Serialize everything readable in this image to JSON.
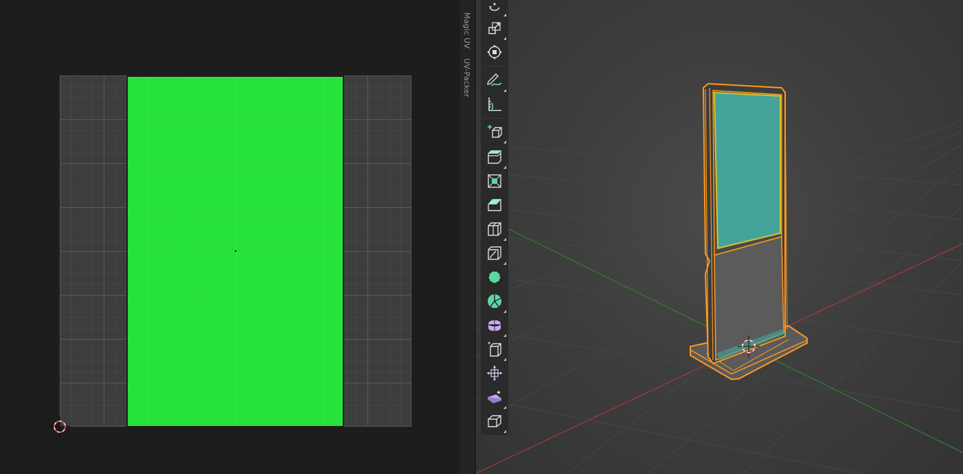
{
  "sidebar": {
    "tabs": [
      {
        "label": "Magic UV"
      },
      {
        "label": "UV-Packer"
      }
    ]
  },
  "uv_editor": {
    "island_color": "#26e23a",
    "grid_color": "#3d3d3d"
  },
  "viewport": {
    "object_outline_color": "#ff9a1f",
    "active_face_color": "#45a49a",
    "x_axis_color": "#b03a3a",
    "y_axis_color": "#3a8a3a"
  },
  "toolbar": {
    "tools": [
      {
        "icon": "rotate-icon"
      },
      {
        "icon": "scale-icon"
      },
      {
        "icon": "transform-icon"
      },
      {
        "icon": "annotate-icon"
      },
      {
        "icon": "measure-icon"
      },
      {
        "icon": "add-cube-icon"
      },
      {
        "icon": "extrude-region-icon"
      },
      {
        "icon": "inset-faces-icon"
      },
      {
        "icon": "bevel-icon"
      },
      {
        "icon": "loop-cut-icon"
      },
      {
        "icon": "knife-icon"
      },
      {
        "icon": "poly-build-icon"
      },
      {
        "icon": "spin-icon"
      },
      {
        "icon": "smooth-icon"
      },
      {
        "icon": "edge-slide-icon"
      },
      {
        "icon": "shrink-fatten-icon"
      },
      {
        "icon": "shear-icon"
      },
      {
        "icon": "rip-region-icon"
      }
    ]
  }
}
